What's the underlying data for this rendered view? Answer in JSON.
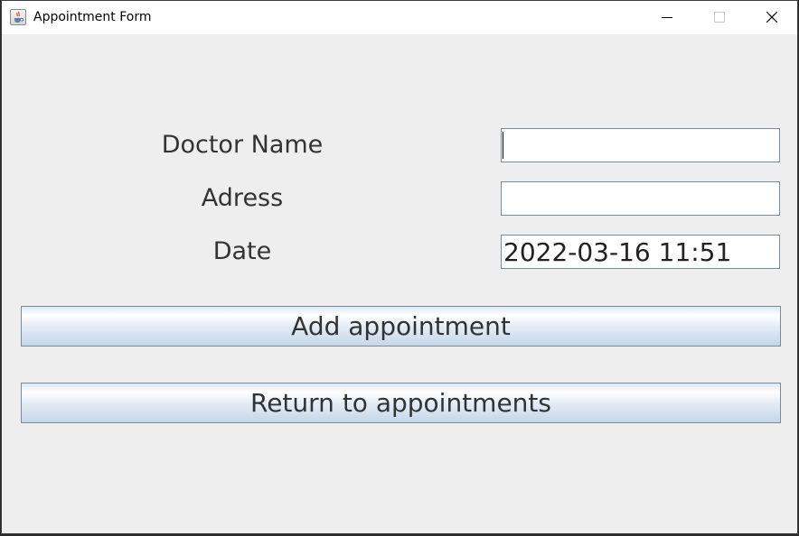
{
  "window": {
    "title": "Appointment Form",
    "icon": "java-cup-icon"
  },
  "titlebar_controls": {
    "minimize_icon": "minimize-icon",
    "maximize_icon": "maximize-icon",
    "close_icon": "close-icon"
  },
  "form": {
    "doctor_name": {
      "label": "Doctor Name",
      "value": ""
    },
    "adress": {
      "label": "Adress",
      "value": ""
    },
    "date": {
      "label": "Date",
      "value": "2022-03-16 11:51"
    }
  },
  "buttons": {
    "add_label": "Add appointment",
    "return_label": "Return to appointments"
  },
  "colors": {
    "window_background": "#eeeeee",
    "titlebar_background": "#ffffff",
    "field_background": "#ffffff",
    "field_border": "#7a8a99",
    "button_gradient_top": "#ffffff",
    "button_gradient_bottom": "#c4d6e8",
    "text": "#333333"
  }
}
